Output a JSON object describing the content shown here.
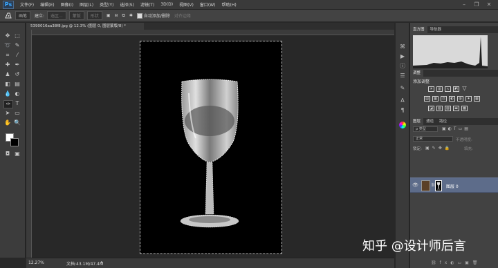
{
  "app": {
    "logo": "Ps"
  },
  "menu": {
    "items": [
      "文件(F)",
      "编辑(E)",
      "图像(I)",
      "图层(L)",
      "类型(Y)",
      "选择(S)",
      "滤镜(T)",
      "3D(D)",
      "视图(V)",
      "窗口(W)",
      "帮助(H)"
    ]
  },
  "window_controls": {
    "minimize": "–",
    "restore": "❐",
    "close": "✕"
  },
  "options_bar": {
    "tool_icon": "brush-icon",
    "mode_label": "画笔",
    "mode_value": "建立:",
    "selection_btn": "选区...",
    "mask_btn": "蒙版",
    "shape_btn": "形状",
    "auto_add_delete": "自动添加/删除",
    "align_edges": "对齐边缘"
  },
  "document": {
    "tab_title": "5390016aa38f8.jpg @ 12.3% (图层 0, 图层蒙版/8) *"
  },
  "status": {
    "zoom": "12.27%",
    "doc_info": "文档:43.1M/47.4M"
  },
  "panels": {
    "histogram_tabs": [
      "直方图",
      "导航器"
    ],
    "adjustments_tab": "调整",
    "adjustments_title": "添加调整",
    "layers_tabs": [
      "图层",
      "通道",
      "路径"
    ],
    "kind_filter": "ρ 类型",
    "blend_mode": "正常",
    "opacity_label": "不透明度:",
    "lock_label": "锁定:",
    "fill_label": "填充:",
    "layer_name": "图层 0"
  },
  "watermark": "知乎 @设计师后言"
}
